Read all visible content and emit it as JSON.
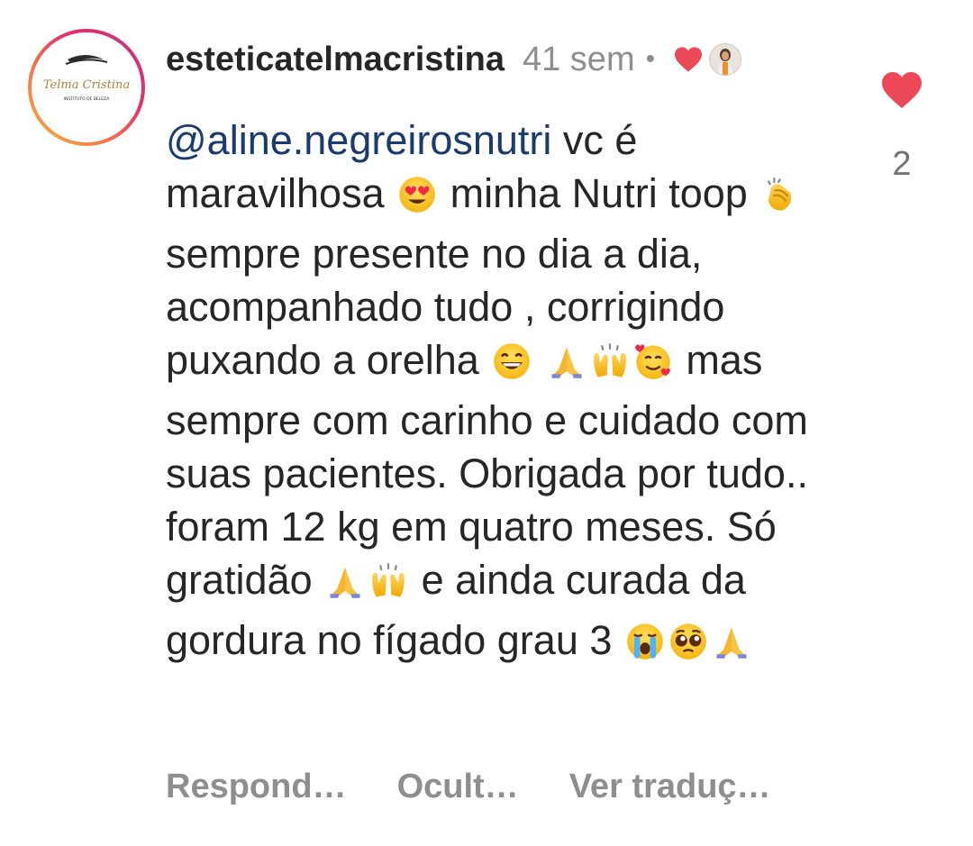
{
  "comment": {
    "username": "esteticatelmacristina",
    "time": "41 sem",
    "separator": "•",
    "avatar_logo_text": "Telma Cristina",
    "avatar_logo_subtext": "INSTITUTO DE BELEZA",
    "like_count": "2",
    "like_icon": "heart-filled-icon",
    "creator_liked_icon": "heart-filled-icon",
    "colors": {
      "heart": "#ed4956",
      "mention": "#1a3b6e",
      "text": "#262626",
      "muted": "#8e8e8e"
    },
    "body": {
      "mention": "@aline.negreirosnutri",
      "seg1": " vc é maravilhosa ",
      "seg2": " minha Nutri toop ",
      "seg3": " sempre presente no dia a dia, acompanhado tudo , corrigindo puxando a orelha ",
      "seg4": " mas sempre com carinho e cuidado com suas pacientes. Obrigada por tudo.. foram 12 kg em  quatro meses. Só gratidão ",
      "seg5": " e ainda curada da gordura no fígado grau 3 "
    },
    "emojis": [
      "heart-eyes",
      "clapping-hands",
      "grinning-face",
      "folded-hands",
      "raising-hands",
      "smiling-face-with-hearts",
      "folded-hands",
      "raising-hands",
      "loudly-crying-face",
      "pleading-face",
      "folded-hands"
    ]
  },
  "actions": {
    "reply": "Respond…",
    "hide": "Ocult…",
    "translate": "Ver traduç…"
  }
}
